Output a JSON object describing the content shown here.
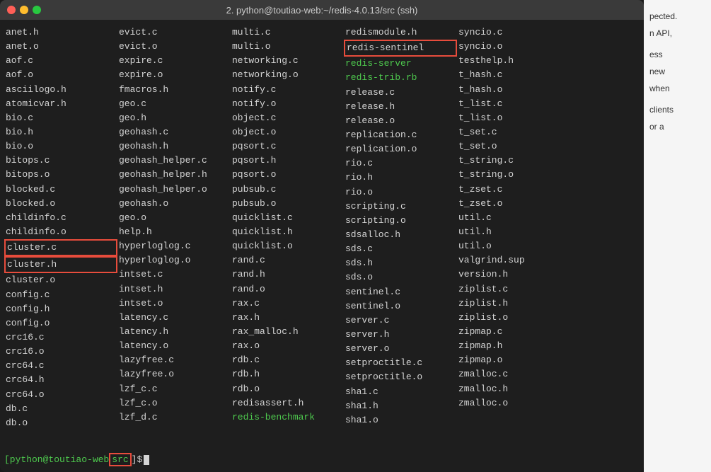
{
  "title": "2. python@toutiao-web:~/redis-4.0.13/src (ssh)",
  "columns": [
    [
      "anet.h",
      "anet.o",
      "aof.c",
      "aof.o",
      "asciilogo.h",
      "atomicvar.h",
      "bio.c",
      "bio.h",
      "bio.o",
      "bitops.c",
      "bitops.o",
      "blocked.c",
      "blocked.o",
      "childinfo.c",
      "childinfo.o",
      "cluster.c",
      "cluster.h",
      "cluster.o",
      "config.c",
      "config.h",
      "config.o",
      "crc16.c",
      "crc16.o",
      "crc64.c",
      "crc64.h",
      "crc64.o",
      "db.c",
      "db.o"
    ],
    [
      "evict.c",
      "evict.o",
      "expire.c",
      "expire.o",
      "fmacros.h",
      "geo.c",
      "geo.h",
      "geohash.c",
      "geohash.h",
      "geohash_helper.c",
      "geohash_helper.h",
      "geohash_helper.o",
      "geohash.o",
      "geo.o",
      "help.h",
      "hyperloglog.c",
      "hyperloglog.o",
      "intset.c",
      "intset.h",
      "intset.o",
      "latency.c",
      "latency.h",
      "latency.o",
      "lazyfree.c",
      "lazyfree.o",
      "lzf_c.c",
      "lzf_c.o",
      "lzf_d.c"
    ],
    [
      "multi.c",
      "multi.o",
      "networking.c",
      "networking.o",
      "notify.c",
      "notify.o",
      "object.c",
      "object.o",
      "pqsort.c",
      "pqsort.h",
      "pqsort.o",
      "pubsub.c",
      "pubsub.o",
      "quicklist.c",
      "quicklist.h",
      "quicklist.o",
      "rand.c",
      "rand.h",
      "rand.o",
      "rax.c",
      "rax.h",
      "rax_malloc.h",
      "rax.o",
      "rdb.c",
      "rdb.h",
      "rdb.o",
      "redisassert.h",
      "redis-benchmark"
    ],
    [
      "redismodule.h",
      "redis-sentinel",
      "redis-server",
      "redis-trib.rb",
      "release.c",
      "release.h",
      "release.o",
      "replication.c",
      "replication.o",
      "rio.c",
      "rio.h",
      "rio.o",
      "scripting.c",
      "scripting.o",
      "sdsalloc.h",
      "sds.c",
      "sds.h",
      "sds.o",
      "sentinel.c",
      "sentinel.o",
      "server.c",
      "server.h",
      "server.o",
      "setproctitle.c",
      "setproctitle.o",
      "sha1.c",
      "sha1.h",
      "sha1.o"
    ],
    [
      "syncio.c",
      "syncio.o",
      "testhelp.h",
      "t_hash.c",
      "t_hash.o",
      "t_list.c",
      "t_list.o",
      "t_set.c",
      "t_set.o",
      "t_string.c",
      "t_string.o",
      "t_zset.c",
      "t_zset.o",
      "util.c",
      "util.h",
      "util.o",
      "valgrind.sup",
      "version.h",
      "ziplist.c",
      "ziplist.h",
      "ziplist.o",
      "zipmap.c",
      "zipmap.h",
      "zipmap.o",
      "zmalloc.c",
      "zmalloc.h",
      "zmalloc.o",
      ""
    ]
  ],
  "green_items": [
    "redis-server",
    "redis-trib.rb",
    "redis-benchmark"
  ],
  "sentinel_item": "redis-sentinel",
  "highlighted_rows": {
    "cluster_c": "cluster.c",
    "cluster_h": "cluster.h"
  },
  "prompt": {
    "user": "[python@toutiao-web",
    "path": "src",
    "symbol": "]$"
  },
  "right_panel": {
    "texts": [
      "pected.",
      "n API,",
      "ess",
      "new",
      "when",
      "clients",
      "or a"
    ]
  }
}
